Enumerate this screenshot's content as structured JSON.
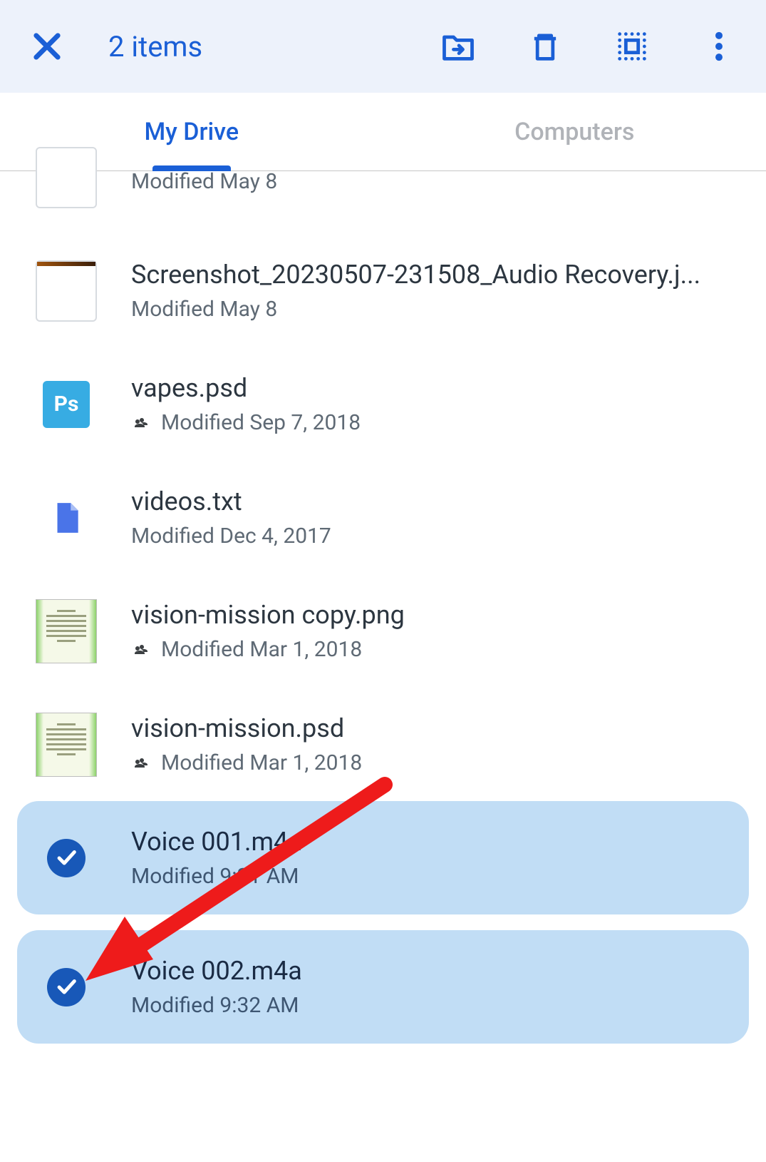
{
  "header": {
    "selection_count_label": "2 items",
    "actions": {
      "close": "close-icon",
      "move": "move-icon",
      "delete": "trash-icon",
      "select_all": "select-all-icon",
      "overflow": "more-vert-icon"
    }
  },
  "tabs": [
    {
      "id": "my-drive",
      "label": "My Drive",
      "active": true
    },
    {
      "id": "computers",
      "label": "Computers",
      "active": false
    }
  ],
  "files": [
    {
      "id": "partial",
      "name": "",
      "modified": "Modified May 8",
      "shared": false,
      "selected": false,
      "thumb_type": "blank-bordered"
    },
    {
      "id": "scr2",
      "name": "Screenshot_20230507-231508_Audio Recovery.j...",
      "modified": "Modified May 8",
      "shared": false,
      "selected": false,
      "thumb_type": "blank-bordered-topstrip"
    },
    {
      "id": "vapes",
      "name": "vapes.psd",
      "modified": "Modified Sep 7, 2018",
      "shared": true,
      "selected": false,
      "thumb_type": "photoshop",
      "thumb_label": "Ps"
    },
    {
      "id": "videos",
      "name": "videos.txt",
      "modified": "Modified Dec 4, 2017",
      "shared": false,
      "selected": false,
      "thumb_type": "generic-file"
    },
    {
      "id": "vm-copy",
      "name": "vision-mission copy.png",
      "modified": "Modified Mar 1, 2018",
      "shared": true,
      "selected": false,
      "thumb_type": "green-doc"
    },
    {
      "id": "vm-psd",
      "name": "vision-mission.psd",
      "modified": "Modified Mar 1, 2018",
      "shared": true,
      "selected": false,
      "thumb_type": "green-doc"
    },
    {
      "id": "voice1",
      "name": "Voice 001.m4a",
      "modified": "Modified 9:31 AM",
      "shared": false,
      "selected": true,
      "thumb_type": "selected-check"
    },
    {
      "id": "voice2",
      "name": "Voice 002.m4a",
      "modified": "Modified 9:32 AM",
      "shared": false,
      "selected": true,
      "thumb_type": "selected-check"
    }
  ],
  "annotation": {
    "type": "red-arrow",
    "target": "voice1-check"
  }
}
